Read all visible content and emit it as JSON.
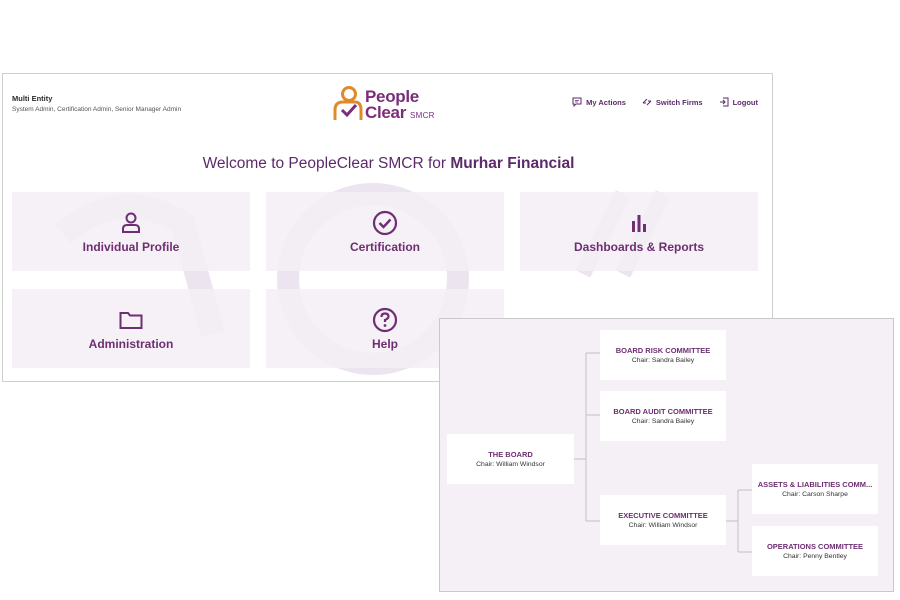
{
  "header": {
    "entity_name": "Multi Entity",
    "entity_roles": "System Admin, Certification Admin, Senior Manager Admin",
    "logo": {
      "line1": "People",
      "line2": "Clear",
      "line3": "SMCR"
    },
    "actions": [
      {
        "label": "My Actions",
        "icon": "chat-icon"
      },
      {
        "label": "Switch Firms",
        "icon": "switch-arrows-icon"
      },
      {
        "label": "Logout",
        "icon": "logout-icon"
      }
    ]
  },
  "welcome": {
    "prefix": "Welcome to PeopleClear SMCR for ",
    "firm": "Murhar Financial"
  },
  "tiles": [
    {
      "label": "Individual Profile",
      "icon": "person-icon"
    },
    {
      "label": "Certification",
      "icon": "check-circle-icon"
    },
    {
      "label": "Dashboards & Reports",
      "icon": "bar-chart-icon"
    },
    {
      "label": "Administration",
      "icon": "folder-icon"
    },
    {
      "label": "Help",
      "icon": "question-circle-icon"
    }
  ],
  "org_chart": {
    "nodes": [
      {
        "title": "THE BOARD",
        "chair": "Chair: William Windsor"
      },
      {
        "title": "BOARD RISK COMMITTEE",
        "chair": "Chair: Sandra Bailey"
      },
      {
        "title": "BOARD AUDIT COMMITTEE",
        "chair": "Chair: Sandra Bailey"
      },
      {
        "title": "EXECUTIVE COMMITTEE",
        "chair": "Chair: William Windsor"
      },
      {
        "title": "ASSETS & LIABILITIES COMM...",
        "chair": "Chair: Carson Sharpe"
      },
      {
        "title": "OPERATIONS COMMITTEE",
        "chair": "Chair: Penny Bentley"
      }
    ]
  },
  "colors": {
    "brand_purple": "#7b2c7b",
    "brand_orange": "#e08a2e",
    "tile_bg": "#f4eef5"
  }
}
